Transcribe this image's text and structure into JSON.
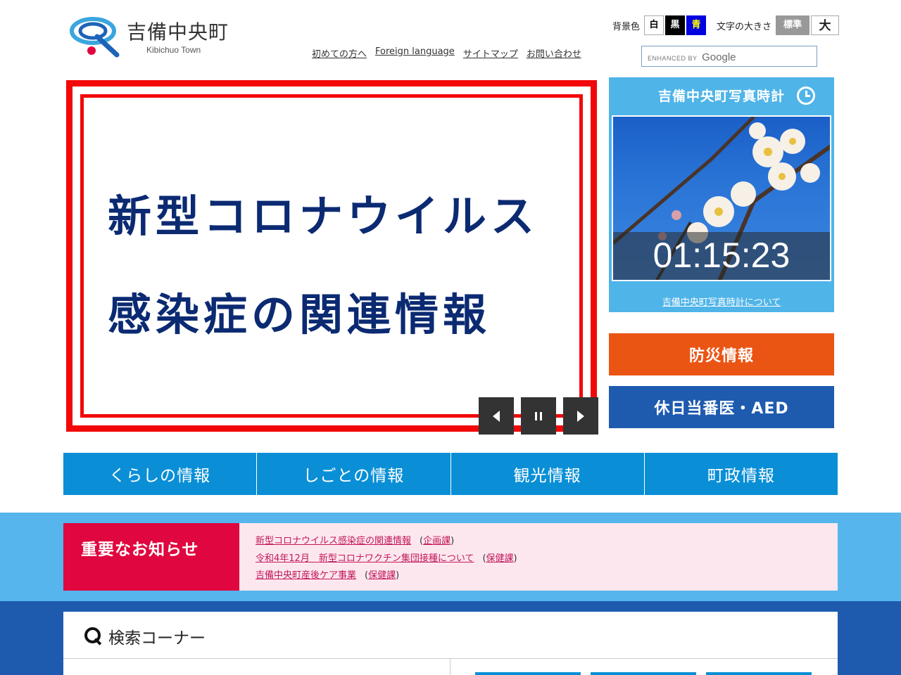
{
  "header": {
    "logo_jp": "吉備中央町",
    "logo_en": "Kibichuo Town",
    "bg_label": "背景色",
    "bg_options": [
      "白",
      "黒",
      "青"
    ],
    "size_label": "文字の大きさ",
    "size_options": [
      "標準",
      "大"
    ],
    "links": [
      "初めての方へ",
      "Foreign language",
      "サイトマップ",
      "お問い合わせ"
    ],
    "search_enhanced": "ENHANCED BY",
    "search_brand": "Google"
  },
  "hero": {
    "line1": "新型コロナウイルス",
    "line2": "感染症の関連情報",
    "controls": [
      "prev",
      "pause",
      "next"
    ]
  },
  "photo_clock": {
    "title": "吉備中央町写真時計",
    "time": "01:15:23",
    "about_link": "吉備中央町写真時計について"
  },
  "side_buttons": {
    "disaster": "防災情報",
    "doctor": "休日当番医・AED"
  },
  "gnav": [
    "くらしの情報",
    "しごとの情報",
    "観光情報",
    "町政情報"
  ],
  "notices": {
    "heading": "重要なお知らせ",
    "items": [
      {
        "title": "新型コロナウイルス感染症の関連情報",
        "dept": "企画課"
      },
      {
        "title": "令和4年12月　新型コロナワクチン集団接種について",
        "dept": "保健課"
      },
      {
        "title": "吉備中央町産後ケア事業",
        "dept": "保健課"
      }
    ]
  },
  "search_corner": {
    "title": "検索コーナー"
  },
  "colors": {
    "hero_red": "#f20808",
    "hero_text": "#0b2a72",
    "clock_bg": "#4fb4e8",
    "disaster": "#ea5514",
    "doctor": "#1e5baf",
    "gnav": "#0a8fd6",
    "notice_head": "#e0063f",
    "notice_bg": "#fde7ee"
  }
}
